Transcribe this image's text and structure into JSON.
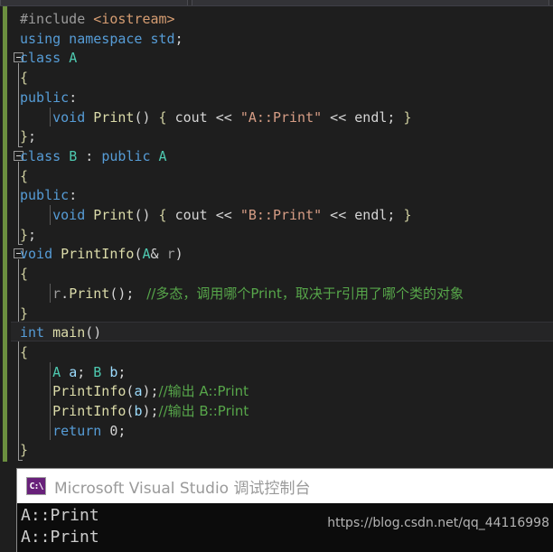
{
  "window": {
    "theme": "visual-studio-dark",
    "colors": {
      "editor_bg": "#1e1e1e",
      "change_bar": "#6b8f3f",
      "keyword": "#569cd6",
      "type": "#4ec9b0",
      "function": "#dcdcaa",
      "string": "#d69d85",
      "comment": "#57a64a",
      "variable": "#9cdcfe",
      "preprocessor": "#9b9b9b",
      "include_path": "#d69d72",
      "console_icon": "#68217a"
    }
  },
  "editor": {
    "lines": [
      {
        "n": 1,
        "fold": false,
        "indent": 0,
        "tokens": [
          {
            "t": "#include ",
            "c": "tk-pre"
          },
          {
            "t": "<iostream>",
            "c": "tk-inc"
          }
        ]
      },
      {
        "n": 2,
        "fold": false,
        "indent": 0,
        "tokens": [
          {
            "t": "using namespace ",
            "c": "tk-kw"
          },
          {
            "t": "std",
            "c": "tk-kw"
          },
          {
            "t": ";",
            "c": "tk-punc"
          }
        ]
      },
      {
        "n": 3,
        "fold": true,
        "indent": 0,
        "tokens": [
          {
            "t": "class ",
            "c": "tk-kw"
          },
          {
            "t": "A",
            "c": "tk-type"
          }
        ]
      },
      {
        "n": 4,
        "fold": false,
        "indent": 0,
        "tokens": [
          {
            "t": "{",
            "c": "tk-brace"
          }
        ]
      },
      {
        "n": 5,
        "fold": false,
        "indent": 0,
        "tokens": [
          {
            "t": "public",
            "c": "tk-kw"
          },
          {
            "t": ":",
            "c": "tk-punc"
          }
        ]
      },
      {
        "n": 6,
        "fold": false,
        "indent": 1,
        "tokens": [
          {
            "t": "    void ",
            "c": "tk-kw"
          },
          {
            "t": "Print",
            "c": "tk-fn"
          },
          {
            "t": "() ",
            "c": "tk-punc"
          },
          {
            "t": "{ ",
            "c": "tk-brace"
          },
          {
            "t": "cout ",
            "c": "tk-plain"
          },
          {
            "t": "<< ",
            "c": "tk-punc"
          },
          {
            "t": "\"A::Print\"",
            "c": "tk-str"
          },
          {
            "t": " << ",
            "c": "tk-punc"
          },
          {
            "t": "endl",
            "c": "tk-plain"
          },
          {
            "t": "; ",
            "c": "tk-punc"
          },
          {
            "t": "}",
            "c": "tk-brace"
          }
        ]
      },
      {
        "n": 7,
        "fold": false,
        "indent": 0,
        "tokens": [
          {
            "t": "}",
            "c": "tk-brace"
          },
          {
            "t": ";",
            "c": "tk-punc"
          }
        ]
      },
      {
        "n": 8,
        "fold": true,
        "indent": 0,
        "tokens": [
          {
            "t": "class ",
            "c": "tk-kw"
          },
          {
            "t": "B ",
            "c": "tk-type"
          },
          {
            "t": ": ",
            "c": "tk-punc"
          },
          {
            "t": "public ",
            "c": "tk-kw"
          },
          {
            "t": "A",
            "c": "tk-type"
          }
        ]
      },
      {
        "n": 9,
        "fold": false,
        "indent": 0,
        "tokens": [
          {
            "t": "{",
            "c": "tk-brace"
          }
        ]
      },
      {
        "n": 10,
        "fold": false,
        "indent": 0,
        "tokens": [
          {
            "t": "public",
            "c": "tk-kw"
          },
          {
            "t": ":",
            "c": "tk-punc"
          }
        ]
      },
      {
        "n": 11,
        "fold": false,
        "indent": 1,
        "tokens": [
          {
            "t": "    void ",
            "c": "tk-kw"
          },
          {
            "t": "Print",
            "c": "tk-fn"
          },
          {
            "t": "() ",
            "c": "tk-punc"
          },
          {
            "t": "{ ",
            "c": "tk-brace"
          },
          {
            "t": "cout ",
            "c": "tk-plain"
          },
          {
            "t": "<< ",
            "c": "tk-punc"
          },
          {
            "t": "\"B::Print\"",
            "c": "tk-str"
          },
          {
            "t": " << ",
            "c": "tk-punc"
          },
          {
            "t": "endl",
            "c": "tk-plain"
          },
          {
            "t": "; ",
            "c": "tk-punc"
          },
          {
            "t": "}",
            "c": "tk-brace"
          }
        ]
      },
      {
        "n": 12,
        "fold": false,
        "indent": 0,
        "tokens": [
          {
            "t": "}",
            "c": "tk-brace"
          },
          {
            "t": ";",
            "c": "tk-punc"
          }
        ]
      },
      {
        "n": 13,
        "fold": true,
        "indent": 0,
        "tokens": [
          {
            "t": "void ",
            "c": "tk-kw"
          },
          {
            "t": "PrintInfo",
            "c": "tk-fn"
          },
          {
            "t": "(",
            "c": "tk-punc"
          },
          {
            "t": "A",
            "c": "tk-type"
          },
          {
            "t": "& ",
            "c": "tk-plain"
          },
          {
            "t": "r",
            "c": "tk-gray"
          },
          {
            "t": ")",
            "c": "tk-punc"
          }
        ]
      },
      {
        "n": 14,
        "fold": false,
        "indent": 0,
        "tokens": [
          {
            "t": "{",
            "c": "tk-brace"
          }
        ]
      },
      {
        "n": 15,
        "fold": false,
        "indent": 1,
        "tokens": [
          {
            "t": "    r",
            "c": "tk-gray"
          },
          {
            "t": ".",
            "c": "tk-punc"
          },
          {
            "t": "Print",
            "c": "tk-fn"
          },
          {
            "t": "(); ",
            "c": "tk-punc"
          },
          {
            "t": " //多态，调用哪个Print，取决于r引用了哪个类的对象",
            "c": "tk-cmt cjk"
          }
        ]
      },
      {
        "n": 16,
        "fold": false,
        "indent": 0,
        "tokens": [
          {
            "t": "}",
            "c": "tk-brace"
          }
        ]
      },
      {
        "n": 17,
        "fold": true,
        "indent": 0,
        "current": true,
        "tokens": [
          {
            "t": "int ",
            "c": "tk-kw"
          },
          {
            "t": "main",
            "c": "tk-fn"
          },
          {
            "t": "()",
            "c": "tk-punc"
          }
        ]
      },
      {
        "n": 18,
        "fold": false,
        "indent": 0,
        "tokens": [
          {
            "t": "{",
            "c": "tk-brace"
          }
        ]
      },
      {
        "n": 19,
        "fold": false,
        "indent": 1,
        "tokens": [
          {
            "t": "    A ",
            "c": "tk-type"
          },
          {
            "t": "a",
            "c": "tk-var"
          },
          {
            "t": "; ",
            "c": "tk-punc"
          },
          {
            "t": "B ",
            "c": "tk-type"
          },
          {
            "t": "b",
            "c": "tk-var"
          },
          {
            "t": ";",
            "c": "tk-punc"
          }
        ]
      },
      {
        "n": 20,
        "fold": false,
        "indent": 1,
        "tokens": [
          {
            "t": "    PrintInfo",
            "c": "tk-fn"
          },
          {
            "t": "(",
            "c": "tk-punc"
          },
          {
            "t": "a",
            "c": "tk-var"
          },
          {
            "t": ");",
            "c": "tk-punc"
          },
          {
            "t": "//输出 A::Print",
            "c": "tk-cmt cjk"
          }
        ]
      },
      {
        "n": 21,
        "fold": false,
        "indent": 1,
        "tokens": [
          {
            "t": "    PrintInfo",
            "c": "tk-fn"
          },
          {
            "t": "(",
            "c": "tk-punc"
          },
          {
            "t": "b",
            "c": "tk-var"
          },
          {
            "t": ");",
            "c": "tk-punc"
          },
          {
            "t": "//输出 B::Print",
            "c": "tk-cmt cjk"
          }
        ]
      },
      {
        "n": 22,
        "fold": false,
        "indent": 1,
        "tokens": [
          {
            "t": "    return ",
            "c": "tk-kw"
          },
          {
            "t": "0",
            "c": "tk-plain"
          },
          {
            "t": ";",
            "c": "tk-punc"
          }
        ]
      },
      {
        "n": 23,
        "fold": false,
        "indent": 0,
        "tokens": [
          {
            "t": "}",
            "c": "tk-brace"
          }
        ]
      }
    ]
  },
  "console": {
    "icon": "command-prompt-icon",
    "icon_label": "C:\\",
    "title": "Microsoft Visual Studio 调试控制台",
    "output": [
      "A::Print",
      "A::Print"
    ]
  },
  "watermark": {
    "text": "https://blog.csdn.net/qq_44116998"
  }
}
